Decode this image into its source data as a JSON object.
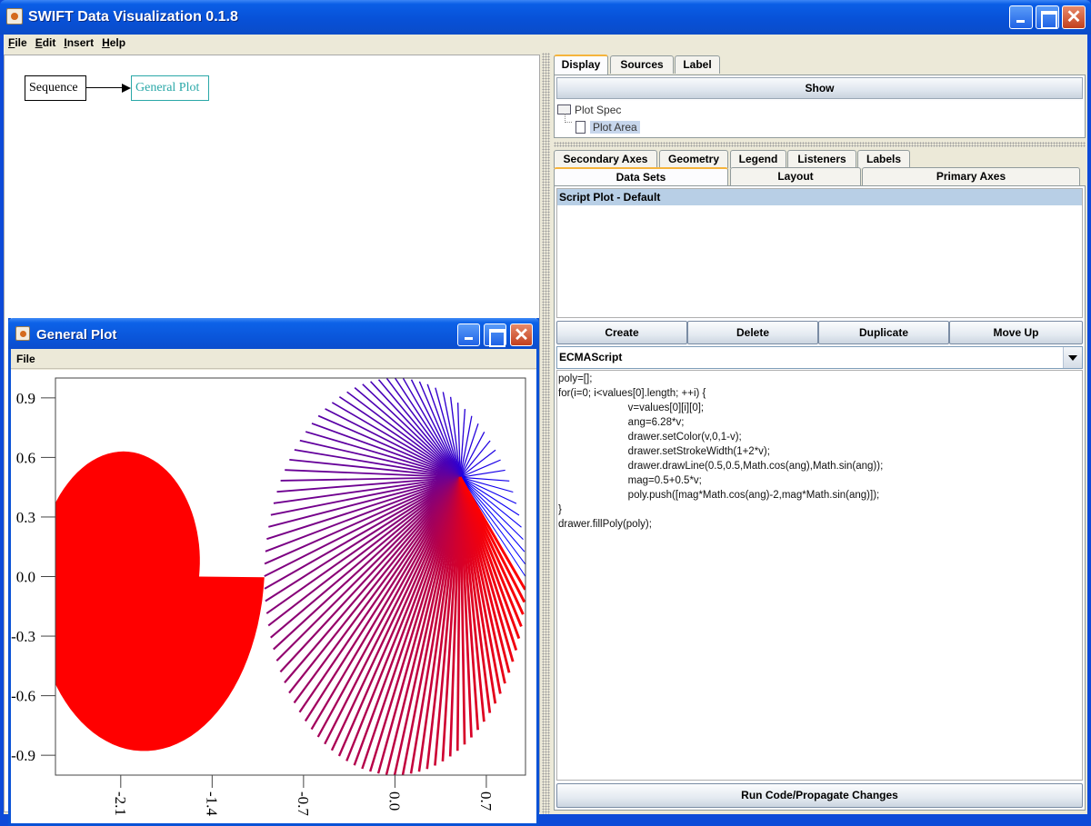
{
  "window": {
    "title": "SWIFT Data Visualization 0.1.8"
  },
  "menubar": {
    "items": [
      "File",
      "Edit",
      "Insert",
      "Help"
    ]
  },
  "graph": {
    "nodes": [
      "Sequence",
      "General Plot"
    ]
  },
  "plot_window": {
    "title": "General Plot",
    "menu": [
      "File"
    ]
  },
  "right": {
    "top_tabs": [
      "Display",
      "Sources",
      "Label"
    ],
    "show_label": "Show",
    "tree": {
      "root": "Plot Spec",
      "child": "Plot Area"
    },
    "tabs_row1": [
      "Secondary Axes",
      "Geometry",
      "Legend",
      "Listeners",
      "Labels"
    ],
    "tabs_row2": [
      "Data Sets",
      "Layout",
      "Primary Axes"
    ],
    "list_item": "Script Plot - Default",
    "buttons": [
      "Create",
      "Delete",
      "Duplicate",
      "Move Up"
    ],
    "language": "ECMAScript",
    "code_lines": [
      "poly=[];",
      "for(i=0; i<values[0].length; ++i) {",
      "                        v=values[0][i][0];",
      "                        ang=6.28*v;",
      "                        drawer.setColor(v,0,1-v);",
      "                        drawer.setStrokeWidth(1+2*v);",
      "                        drawer.drawLine(0.5,0.5,Math.cos(ang),Math.sin(ang));",
      "                        mag=0.5+0.5*v;",
      "                        poly.push([mag*Math.cos(ang)-2,mag*Math.sin(ang)]);",
      "}",
      "drawer.fillPoly(poly);"
    ],
    "run_label": "Run Code/Propagate Changes"
  },
  "chart_data": {
    "type": "scatter",
    "title": "",
    "xlabel": "",
    "ylabel": "",
    "xlim": [
      -2.6,
      1.0
    ],
    "ylim": [
      -1.0,
      1.0
    ],
    "y_ticks": [
      0.9,
      0.6,
      0.3,
      0.0,
      -0.3,
      -0.6,
      -0.9
    ],
    "y_tick_labels": [
      "0.9",
      "0.6",
      "0.3",
      "0.0",
      "-0.3",
      "-0.6",
      "-0.9"
    ],
    "x_ticks": [
      -2.1,
      -1.4,
      -0.7,
      0.0,
      0.7
    ],
    "x_tick_labels": [
      "-2.1",
      "-1.4",
      "-0.7",
      "0.0",
      "0.7"
    ],
    "grid": false,
    "series": [
      {
        "type": "filled-polygon",
        "color": "#ff0000",
        "center": [
          -2,
          0
        ],
        "radius_from": 0.5,
        "radius_to": 1.0
      },
      {
        "type": "line-fan",
        "origin": [
          0.5,
          0.5
        ],
        "count": 100,
        "color_from": "#0000ff",
        "color_to": "#ff0000",
        "stroke_from": 1,
        "stroke_to": 3
      }
    ]
  }
}
